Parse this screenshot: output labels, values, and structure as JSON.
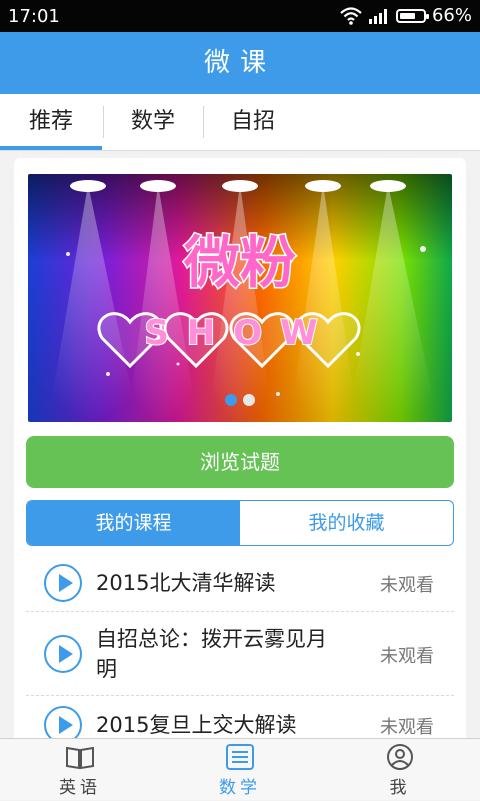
{
  "status_bar": {
    "time": "17:01",
    "battery": "66%",
    "battery_level": 0.66
  },
  "header": {
    "title": "微课"
  },
  "tabs": [
    {
      "label": "推荐",
      "active": true
    },
    {
      "label": "数学",
      "active": false
    },
    {
      "label": "自招",
      "active": false
    }
  ],
  "banner": {
    "title_line1": "微粉",
    "title_line2": "SHOW",
    "pages": 2,
    "current_page": 1
  },
  "browse_button": {
    "label": "浏览试题"
  },
  "segments": [
    {
      "label": "我的课程",
      "active": true
    },
    {
      "label": "我的收藏",
      "active": false
    }
  ],
  "courses": [
    {
      "title": "2015北大清华解读",
      "status": "未观看"
    },
    {
      "title": "自招总论：拨开云雾见月明",
      "status": "未观看"
    },
    {
      "title": "2015复旦上交大解读",
      "status": "未观看"
    }
  ],
  "bottom_nav": [
    {
      "label": "英语",
      "icon": "book-icon",
      "active": false
    },
    {
      "label": "数学",
      "icon": "list-icon",
      "active": true
    },
    {
      "label": "我",
      "icon": "person-icon",
      "active": false
    }
  ],
  "colors": {
    "accent": "#3d9be9",
    "green": "#67c256"
  }
}
